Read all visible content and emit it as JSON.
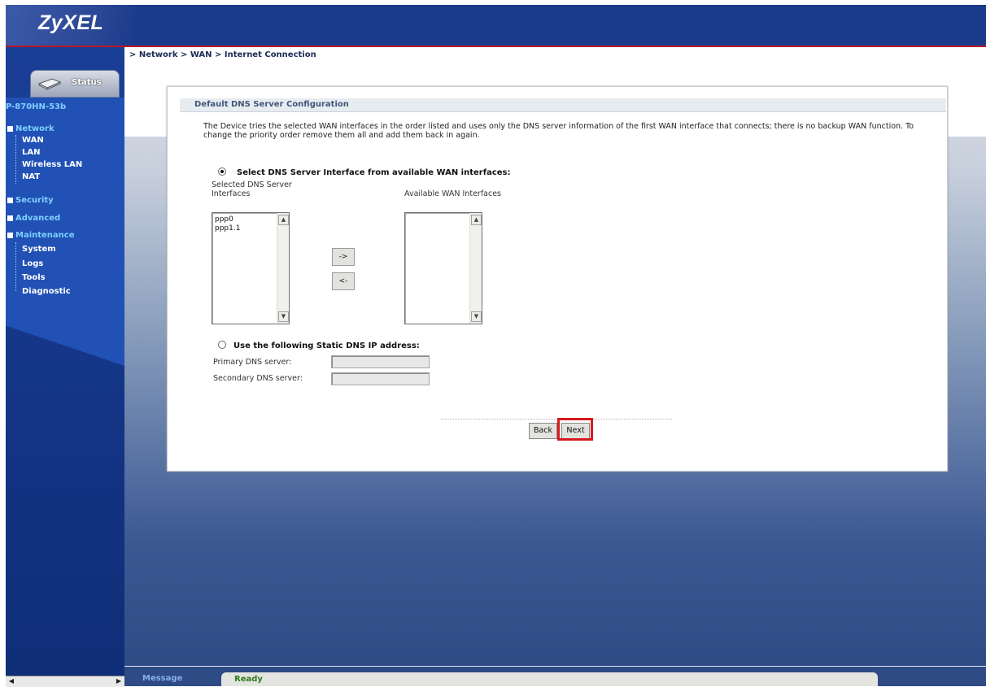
{
  "app": {
    "logo": "ZyXEL"
  },
  "breadcrumb": "> Network > WAN > Internet Connection",
  "sidebar": {
    "status_tab": "Status",
    "model": "P-870HN-53b",
    "groups": {
      "network": "Network",
      "security": "Security",
      "advanced": "Advanced",
      "maintenance": "Maintenance"
    },
    "network_items": [
      "WAN",
      "LAN",
      "Wireless LAN",
      "NAT"
    ],
    "maintenance_items": [
      "System",
      "Logs",
      "Tools",
      "Diagnostic"
    ]
  },
  "page": {
    "section_title": "Default DNS Server Configuration",
    "description": "The Device tries the selected WAN interfaces in the order listed and uses only the DNS server information of the first WAN interface that connects; there is no backup WAN function. To change the priority order remove them all and add them back in again.",
    "option_interface": {
      "label": "Select DNS Server Interface from available WAN interfaces:",
      "selected": true
    },
    "selected_list_label": "Selected DNS Server Interfaces",
    "available_list_label": "Available WAN Interfaces",
    "selected_items": [
      "ppp0",
      "ppp1.1"
    ],
    "available_items": [],
    "move_right_label": "->",
    "move_left_label": "<-",
    "option_static": {
      "label": "Use the following Static DNS IP address:",
      "selected": false
    },
    "primary_dns_label": "Primary DNS server:",
    "primary_dns_value": "",
    "secondary_dns_label": "Secondary DNS server:",
    "secondary_dns_value": "",
    "back_label": "Back",
    "next_label": "Next"
  },
  "statusbar": {
    "message_label": "Message",
    "status_text": "Ready"
  },
  "colors": {
    "banner": "#1b3a8a",
    "sidebar": "#2151b5",
    "highlight": "#d71920",
    "ready": "#2f7a1e"
  }
}
